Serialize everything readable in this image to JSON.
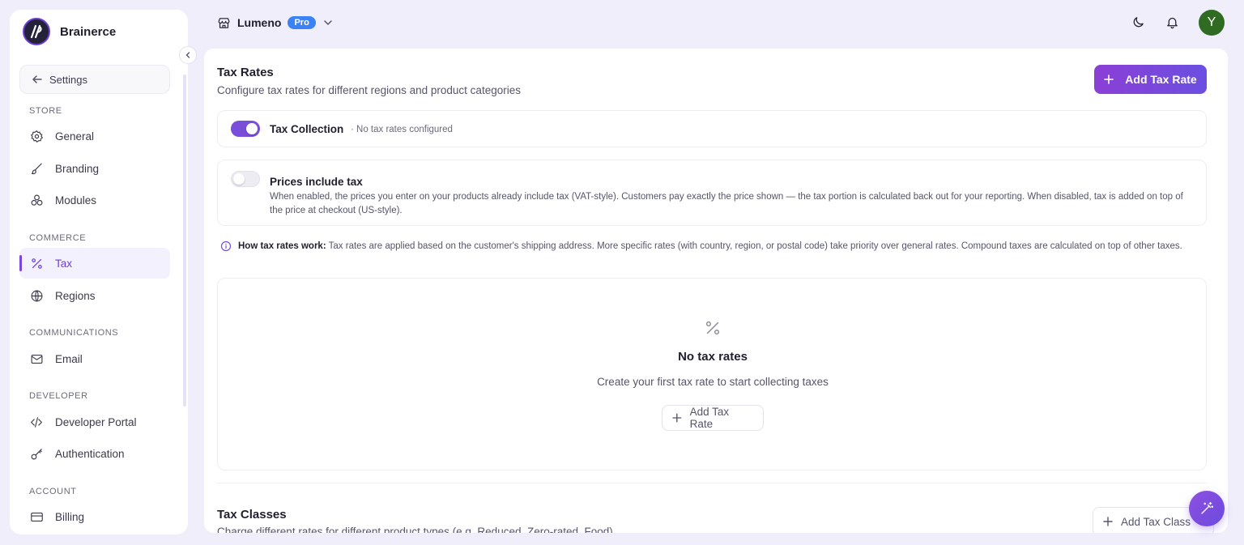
{
  "brand": {
    "name": "Brainerce"
  },
  "sidebar": {
    "back_label": "Settings",
    "sections": [
      {
        "label": "STORE",
        "items": [
          {
            "label": "General",
            "icon": "gear-icon"
          },
          {
            "label": "Branding",
            "icon": "brush-icon"
          },
          {
            "label": "Modules",
            "icon": "modules-icon"
          }
        ]
      },
      {
        "label": "COMMERCE",
        "items": [
          {
            "label": "Tax",
            "icon": "percent-icon",
            "active": true
          },
          {
            "label": "Regions",
            "icon": "globe-icon"
          }
        ]
      },
      {
        "label": "COMMUNICATIONS",
        "items": [
          {
            "label": "Email",
            "icon": "mail-icon"
          }
        ]
      },
      {
        "label": "DEVELOPER",
        "items": [
          {
            "label": "Developer Portal",
            "icon": "code-icon"
          },
          {
            "label": "Authentication",
            "icon": "key-icon"
          }
        ]
      },
      {
        "label": "ACCOUNT",
        "items": [
          {
            "label": "Billing",
            "icon": "card-icon"
          }
        ]
      }
    ]
  },
  "topbar": {
    "store_name": "Lumeno",
    "plan_badge": "Pro",
    "avatar_initial": "Y"
  },
  "main": {
    "title": "Tax Rates",
    "subtitle": "Configure tax rates for different regions and product categories",
    "add_button_label": "Add Tax Rate",
    "tax_collection": {
      "label": "Tax Collection",
      "status": "· No tax rates configured",
      "enabled": true
    },
    "prices_include_tax": {
      "label": "Prices include tax",
      "description": "When enabled, the prices you enter on your products already include tax (VAT-style). Customers pay exactly the price shown — the tax portion is calculated back out for your reporting. When disabled, tax is added on top of the price at checkout (US-style).",
      "enabled": false
    },
    "info": {
      "heading": "How tax rates work:",
      "text": "Tax rates are applied based on the customer's shipping address. More specific rates (with country, region, or postal code) take priority over general rates. Compound taxes are calculated on top of other taxes."
    },
    "empty_state": {
      "title": "No tax rates",
      "subtitle": "Create your first tax rate to start collecting taxes",
      "button_label": "Add Tax Rate"
    },
    "tax_classes": {
      "title": "Tax Classes",
      "subtitle": "Charge different rates for different product types (e.g. Reduced, Zero-rated, Food)",
      "button_label": "Add Tax Class"
    }
  },
  "colors": {
    "accent": "#7748db",
    "badge": "#3b82f6",
    "avatar": "#2f6b22",
    "background": "#efeefa"
  }
}
